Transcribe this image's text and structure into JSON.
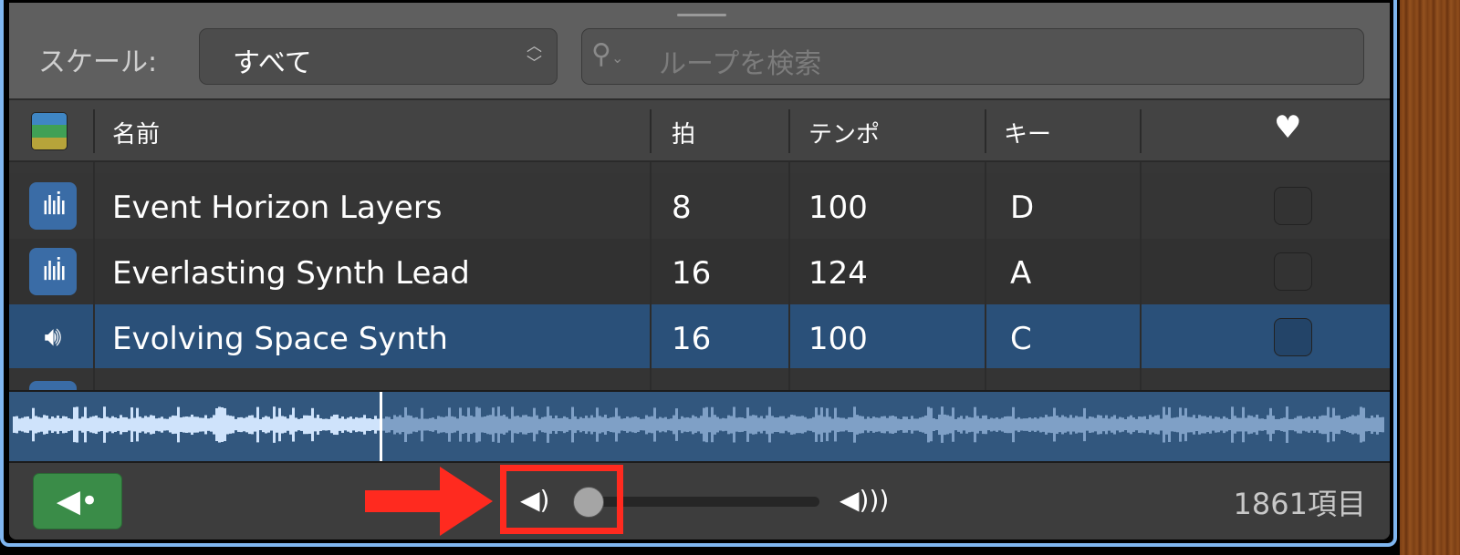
{
  "toolbar": {
    "scale_label": "スケール:",
    "scale_value": "すべて",
    "search_placeholder": "ループを検索"
  },
  "columns": {
    "name": "名前",
    "beats": "拍",
    "tempo": "テンポ",
    "key": "キー",
    "favorite": "♥"
  },
  "rows": [
    {
      "name": "Event Horizon Layers",
      "beats": "8",
      "tempo": "100",
      "key": "D",
      "icon": "waveform-icon",
      "selected": false
    },
    {
      "name": "Everlasting Synth Lead",
      "beats": "16",
      "tempo": "124",
      "key": "A",
      "icon": "waveform-icon",
      "selected": false
    },
    {
      "name": "Evolving Space Synth",
      "beats": "16",
      "tempo": "100",
      "key": "C",
      "icon": "speaker-playing-icon",
      "selected": true
    }
  ],
  "preview": {
    "playhead_fraction": 0.27
  },
  "footer": {
    "volume_fraction": 0.0,
    "item_count": "1861項目"
  },
  "colors": {
    "selected_row": "#2a5079",
    "preview_button": "#3a8c48",
    "annotation": "#ff2a1f"
  }
}
